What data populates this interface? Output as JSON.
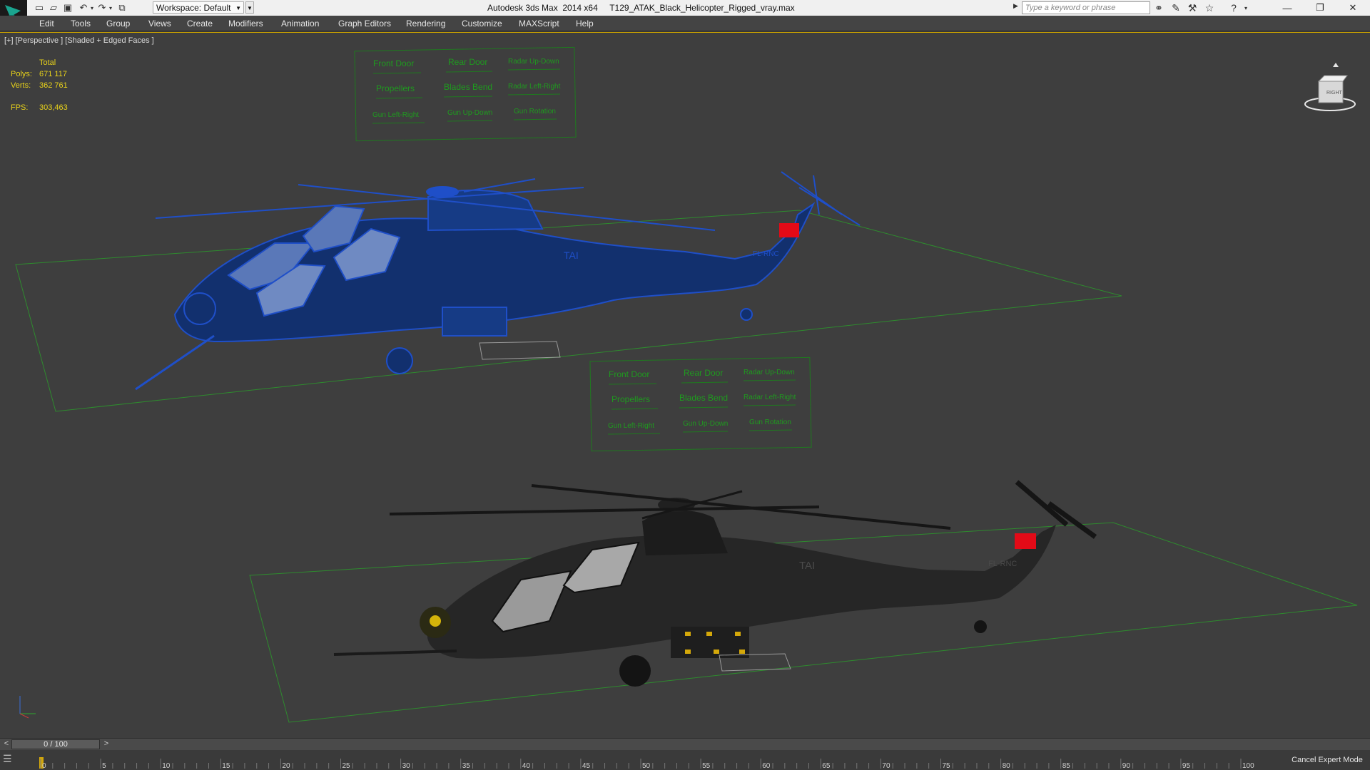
{
  "titlebar": {
    "workspace_label": "Workspace: Default",
    "window_title": "Autodesk 3ds Max  2014 x64     T129_ATAK_Black_Helicopter_Rigged_vray.max",
    "search_placeholder": "Type a keyword or phrase"
  },
  "menu": [
    "Edit",
    "Tools",
    "Group",
    "Views",
    "Create",
    "Modifiers",
    "Animation",
    "Graph Editors",
    "Rendering",
    "Customize",
    "MAXScript",
    "Help"
  ],
  "viewport": {
    "label": "[+] [Perspective ] [Shaded + Edged Faces ]",
    "stats": {
      "total_label": "Total",
      "polys_label": "Polys:",
      "polys_value": "671 117",
      "verts_label": "Verts:",
      "verts_value": "362 761",
      "fps_label": "FPS:",
      "fps_value": "303,463"
    },
    "viewcube_label": "RIGHT"
  },
  "control_panels": {
    "labels": [
      "Front Door",
      "Rear Door",
      "Radar Up-Down",
      "Propellers",
      "Blades Bend",
      "Radar Left-Right",
      "Gun Left-Right",
      "Gun Up-Down",
      "Gun Rotation"
    ]
  },
  "helicopter": {
    "tail_code": "FL-RNC",
    "maker_mark": "TAI"
  },
  "timeline": {
    "frame_display": "0 / 100",
    "prev": "<",
    "next": ">",
    "ticks": [
      "0",
      "5",
      "10",
      "15",
      "20",
      "25",
      "30",
      "35",
      "40",
      "45",
      "50",
      "55",
      "60",
      "65",
      "70",
      "75",
      "80",
      "85",
      "90",
      "95",
      "100"
    ]
  },
  "status": {
    "cancel_expert_mode": "Cancel Expert Mode"
  },
  "colors": {
    "wire_blue": "#1f4fc8",
    "ui_green": "#1f9a1f",
    "stat_yellow": "#e8d21a",
    "flag_red": "#e30a17"
  }
}
